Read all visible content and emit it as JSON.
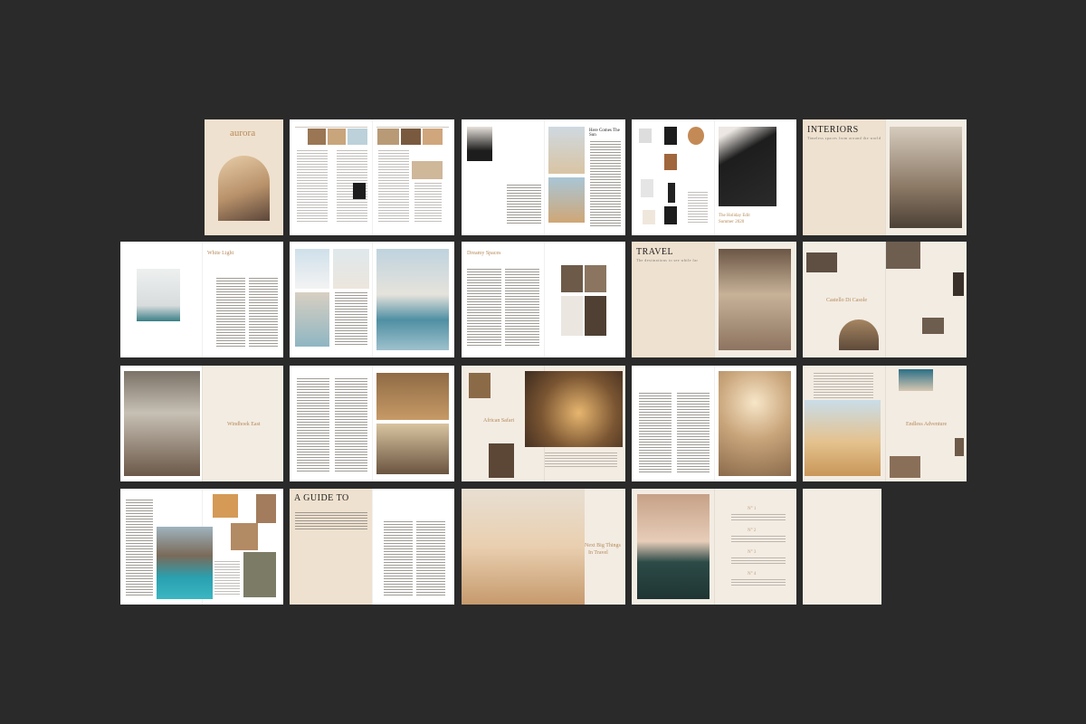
{
  "spreads": [
    {
      "id": "cover",
      "title": "aurora"
    },
    {
      "id": "contents"
    },
    {
      "id": "here-comes-the-sun",
      "title": "Here Comes The Sun"
    },
    {
      "id": "holiday-edit",
      "title": "The Holiday Edit",
      "subtitle": "Summer 2020"
    },
    {
      "id": "interiors",
      "title": "INTERIORS",
      "subtitle": "Timeless spaces from around the world"
    },
    {
      "id": "white-light",
      "title": "White Light"
    },
    {
      "id": "pool"
    },
    {
      "id": "dreamy-spaces",
      "title": "Dreamy Spaces"
    },
    {
      "id": "travel",
      "title": "TRAVEL",
      "subtitle": "The destinations to see while far"
    },
    {
      "id": "castello",
      "title": "Castello Di Casole"
    },
    {
      "id": "windhoek",
      "title": "Windhoek East"
    },
    {
      "id": "lodge"
    },
    {
      "id": "african-safari",
      "title": "African Safari"
    },
    {
      "id": "boardwalk"
    },
    {
      "id": "endless-adventure",
      "title": "Endless Adventure"
    },
    {
      "id": "coast"
    },
    {
      "id": "a-guide-to",
      "title": "A GUIDE TO"
    },
    {
      "id": "next-big-things",
      "title": "Next Big Things",
      "line2": "In Travel"
    },
    {
      "id": "numbered-list",
      "items": [
        "N° 1",
        "N° 2",
        "N° 3",
        "N° 4"
      ]
    },
    {
      "id": "blank"
    }
  ],
  "colors": {
    "background": "#2a2a2a",
    "cream": "#f3ece3",
    "beige": "#efe1cf",
    "gold": "#b58a58"
  }
}
